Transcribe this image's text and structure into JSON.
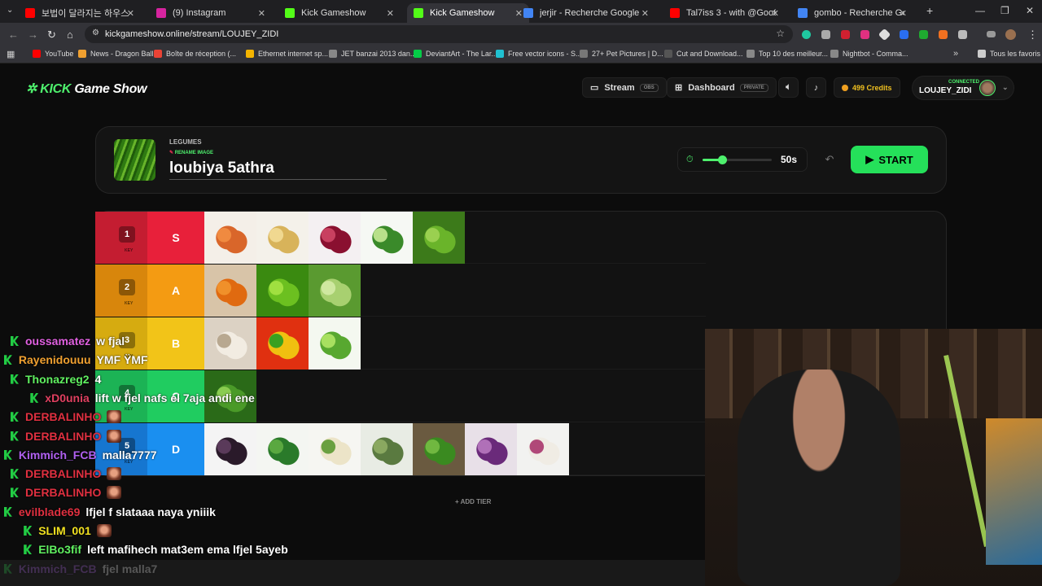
{
  "browser": {
    "tabs": [
      {
        "title": "보법이 달라지는 하우스 - YouT",
        "icon": "youtube-icon",
        "color": "#ff0000"
      },
      {
        "title": "(9) Instagram",
        "icon": "instagram-icon",
        "color": "#d6249f"
      },
      {
        "title": "Kick Gameshow",
        "icon": "kick-icon",
        "color": "#53fc18"
      },
      {
        "title": "Kick Gameshow",
        "icon": "kick-icon",
        "color": "#53fc18",
        "active": true
      },
      {
        "title": "jerjir - Recherche Google",
        "icon": "google-icon",
        "color": "#4285f4"
      },
      {
        "title": "Tal7iss 3 - with @Goo8a - YouT",
        "icon": "youtube-icon",
        "color": "#ff0000"
      },
      {
        "title": "gombo - Recherche Google",
        "icon": "google-icon",
        "color": "#4285f4"
      }
    ],
    "url": "kickgameshow.online/stream/LOUJEY_ZIDI",
    "bookmarks": [
      {
        "label": "YouTube",
        "color": "#ff0000"
      },
      {
        "label": "News - Dragon Ball...",
        "color": "#f0a030"
      },
      {
        "label": "Boîte de réception (...",
        "color": "#ea4335"
      },
      {
        "label": "Ethernet internet sp...",
        "color": "#f4b400"
      },
      {
        "label": "JET banzai 2013 dan...",
        "color": "#888888"
      },
      {
        "label": "DeviantArt - The Lar...",
        "color": "#05cc47"
      },
      {
        "label": "Free vector icons - S...",
        "color": "#20c0d0"
      },
      {
        "label": "27+ Pet Pictures | D...",
        "color": "#777777"
      },
      {
        "label": "Cut and Download...",
        "color": "#555555"
      },
      {
        "label": "Top 10 des meilleur...",
        "color": "#888888"
      },
      {
        "label": "Nightbot - Comma...",
        "color": "#888888"
      }
    ],
    "all_bookmarks": "Tous les favoris"
  },
  "site": {
    "logo_kick": "KICK",
    "logo_rest": " Game Show",
    "stream_label": "Stream",
    "stream_badge": "OBS",
    "dashboard_label": "Dashboard",
    "dashboard_badge": "PRIVATE",
    "credits": "499 Credits",
    "connected_label": "CONNECTED",
    "username": "LOUJEY_ZIDI"
  },
  "editor": {
    "category": "LEGUMES",
    "rename_label": "RENAME IMAGE",
    "item_name": "loubiya 5athra",
    "timer_value": "50s",
    "timer_fraction": 0.28,
    "start_label": "START"
  },
  "tiers": [
    {
      "key": "1",
      "key_hint": "KEY",
      "label": "S",
      "color": "#e8203a",
      "keycolor": "#c41d31",
      "items": [
        "sweet-potato",
        "potato",
        "red-onion",
        "cucumber",
        "peas"
      ]
    },
    {
      "key": "2",
      "key_hint": "KEY",
      "label": "A",
      "color": "#f49b12",
      "keycolor": "#d8860c",
      "items": [
        "carrot",
        "green-peppers",
        "broad-beans"
      ]
    },
    {
      "key": "3",
      "key_hint": "KEY",
      "label": "B",
      "color": "#f2c418",
      "keycolor": "#d6ab10",
      "items": [
        "mushrooms",
        "bell-peppers",
        "lettuce"
      ]
    },
    {
      "key": "4",
      "key_hint": "KEY",
      "label": "C",
      "color": "#20cc60",
      "keycolor": "#1cb355",
      "items": [
        "spinach"
      ]
    },
    {
      "key": "5",
      "key_hint": "KEY",
      "label": "D",
      "color": "#1a8ff0",
      "keycolor": "#1676d0",
      "items": [
        "eggplant",
        "broccoli",
        "cauliflower",
        "artichoke",
        "parsley",
        "red-cabbage",
        "turnip"
      ]
    }
  ],
  "add_tier": "ADD TIER",
  "chat": [
    {
      "user": "oussamatez",
      "color": "#e060e0",
      "msg": "w fjal"
    },
    {
      "user": "Rayenidouuu",
      "color": "#f0a030",
      "msg": "YMF ŸMF"
    },
    {
      "user": "Thonazreg2",
      "color": "#60f060",
      "msg": "4"
    },
    {
      "user": "xD0unia",
      "color": "#e04060",
      "msg": "lift w fjel nafs el 7aja andi ene"
    },
    {
      "user": "DERBALINHO",
      "color": "#e03040",
      "msg": "",
      "emote": true
    },
    {
      "user": "DERBALINHO",
      "color": "#e03040",
      "msg": "",
      "emote": true
    },
    {
      "user": "Kimmich_FCB",
      "color": "#b060f0",
      "msg": "malla7777"
    },
    {
      "user": "DERBALINHO",
      "color": "#e03040",
      "msg": "",
      "emote": true
    },
    {
      "user": "DERBALINHO",
      "color": "#e03040",
      "msg": "",
      "emote": true
    },
    {
      "user": "evilblade69",
      "color": "#e03040",
      "msg": "lfjel f slataaa naya yniiik"
    },
    {
      "user": "SLIM_001",
      "color": "#f0e020",
      "msg": "",
      "emote": true
    },
    {
      "user": "ElBo3fif",
      "color": "#60f060",
      "msg": "left mafihech mat3em ema lfjel 5ayeb"
    },
    {
      "user": "Kimmich_FCB",
      "color": "#b060f0",
      "msg": "fjel malla7"
    }
  ]
}
